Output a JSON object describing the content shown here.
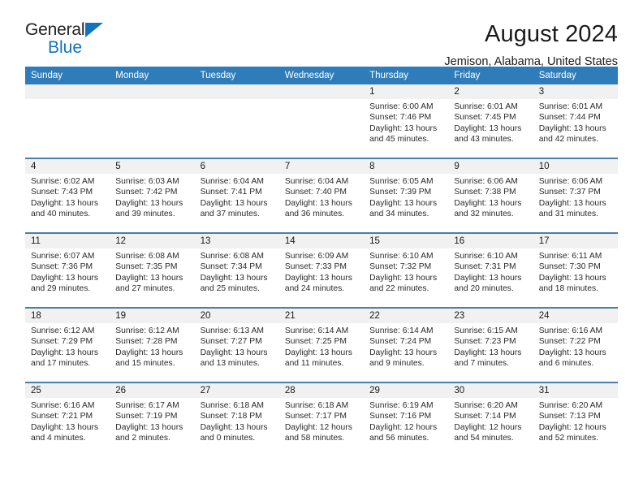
{
  "brand": {
    "name_part1": "General",
    "name_part2": "Blue",
    "accent_color": "#1275bc",
    "triangle_icon": "triangle-icon"
  },
  "header": {
    "title": "August 2024",
    "subtitle": "Jemison, Alabama, United States"
  },
  "calendar": {
    "header_bg": "#2e7cba",
    "row_divider_color": "#4a7fa8",
    "daynum_band_bg": "#f1f1f1",
    "weekdays": [
      "Sunday",
      "Monday",
      "Tuesday",
      "Wednesday",
      "Thursday",
      "Friday",
      "Saturday"
    ],
    "weeks": [
      [
        {
          "day": "",
          "sunrise": "",
          "sunset": "",
          "daylight1": "",
          "daylight2": "",
          "empty": true
        },
        {
          "day": "",
          "sunrise": "",
          "sunset": "",
          "daylight1": "",
          "daylight2": "",
          "empty": true
        },
        {
          "day": "",
          "sunrise": "",
          "sunset": "",
          "daylight1": "",
          "daylight2": "",
          "empty": true
        },
        {
          "day": "",
          "sunrise": "",
          "sunset": "",
          "daylight1": "",
          "daylight2": "",
          "empty": true
        },
        {
          "day": "1",
          "sunrise": "Sunrise: 6:00 AM",
          "sunset": "Sunset: 7:46 PM",
          "daylight1": "Daylight: 13 hours",
          "daylight2": "and 45 minutes."
        },
        {
          "day": "2",
          "sunrise": "Sunrise: 6:01 AM",
          "sunset": "Sunset: 7:45 PM",
          "daylight1": "Daylight: 13 hours",
          "daylight2": "and 43 minutes."
        },
        {
          "day": "3",
          "sunrise": "Sunrise: 6:01 AM",
          "sunset": "Sunset: 7:44 PM",
          "daylight1": "Daylight: 13 hours",
          "daylight2": "and 42 minutes."
        }
      ],
      [
        {
          "day": "4",
          "sunrise": "Sunrise: 6:02 AM",
          "sunset": "Sunset: 7:43 PM",
          "daylight1": "Daylight: 13 hours",
          "daylight2": "and 40 minutes."
        },
        {
          "day": "5",
          "sunrise": "Sunrise: 6:03 AM",
          "sunset": "Sunset: 7:42 PM",
          "daylight1": "Daylight: 13 hours",
          "daylight2": "and 39 minutes."
        },
        {
          "day": "6",
          "sunrise": "Sunrise: 6:04 AM",
          "sunset": "Sunset: 7:41 PM",
          "daylight1": "Daylight: 13 hours",
          "daylight2": "and 37 minutes."
        },
        {
          "day": "7",
          "sunrise": "Sunrise: 6:04 AM",
          "sunset": "Sunset: 7:40 PM",
          "daylight1": "Daylight: 13 hours",
          "daylight2": "and 36 minutes."
        },
        {
          "day": "8",
          "sunrise": "Sunrise: 6:05 AM",
          "sunset": "Sunset: 7:39 PM",
          "daylight1": "Daylight: 13 hours",
          "daylight2": "and 34 minutes."
        },
        {
          "day": "9",
          "sunrise": "Sunrise: 6:06 AM",
          "sunset": "Sunset: 7:38 PM",
          "daylight1": "Daylight: 13 hours",
          "daylight2": "and 32 minutes."
        },
        {
          "day": "10",
          "sunrise": "Sunrise: 6:06 AM",
          "sunset": "Sunset: 7:37 PM",
          "daylight1": "Daylight: 13 hours",
          "daylight2": "and 31 minutes."
        }
      ],
      [
        {
          "day": "11",
          "sunrise": "Sunrise: 6:07 AM",
          "sunset": "Sunset: 7:36 PM",
          "daylight1": "Daylight: 13 hours",
          "daylight2": "and 29 minutes."
        },
        {
          "day": "12",
          "sunrise": "Sunrise: 6:08 AM",
          "sunset": "Sunset: 7:35 PM",
          "daylight1": "Daylight: 13 hours",
          "daylight2": "and 27 minutes."
        },
        {
          "day": "13",
          "sunrise": "Sunrise: 6:08 AM",
          "sunset": "Sunset: 7:34 PM",
          "daylight1": "Daylight: 13 hours",
          "daylight2": "and 25 minutes."
        },
        {
          "day": "14",
          "sunrise": "Sunrise: 6:09 AM",
          "sunset": "Sunset: 7:33 PM",
          "daylight1": "Daylight: 13 hours",
          "daylight2": "and 24 minutes."
        },
        {
          "day": "15",
          "sunrise": "Sunrise: 6:10 AM",
          "sunset": "Sunset: 7:32 PM",
          "daylight1": "Daylight: 13 hours",
          "daylight2": "and 22 minutes."
        },
        {
          "day": "16",
          "sunrise": "Sunrise: 6:10 AM",
          "sunset": "Sunset: 7:31 PM",
          "daylight1": "Daylight: 13 hours",
          "daylight2": "and 20 minutes."
        },
        {
          "day": "17",
          "sunrise": "Sunrise: 6:11 AM",
          "sunset": "Sunset: 7:30 PM",
          "daylight1": "Daylight: 13 hours",
          "daylight2": "and 18 minutes."
        }
      ],
      [
        {
          "day": "18",
          "sunrise": "Sunrise: 6:12 AM",
          "sunset": "Sunset: 7:29 PM",
          "daylight1": "Daylight: 13 hours",
          "daylight2": "and 17 minutes."
        },
        {
          "day": "19",
          "sunrise": "Sunrise: 6:12 AM",
          "sunset": "Sunset: 7:28 PM",
          "daylight1": "Daylight: 13 hours",
          "daylight2": "and 15 minutes."
        },
        {
          "day": "20",
          "sunrise": "Sunrise: 6:13 AM",
          "sunset": "Sunset: 7:27 PM",
          "daylight1": "Daylight: 13 hours",
          "daylight2": "and 13 minutes."
        },
        {
          "day": "21",
          "sunrise": "Sunrise: 6:14 AM",
          "sunset": "Sunset: 7:25 PM",
          "daylight1": "Daylight: 13 hours",
          "daylight2": "and 11 minutes."
        },
        {
          "day": "22",
          "sunrise": "Sunrise: 6:14 AM",
          "sunset": "Sunset: 7:24 PM",
          "daylight1": "Daylight: 13 hours",
          "daylight2": "and 9 minutes."
        },
        {
          "day": "23",
          "sunrise": "Sunrise: 6:15 AM",
          "sunset": "Sunset: 7:23 PM",
          "daylight1": "Daylight: 13 hours",
          "daylight2": "and 7 minutes."
        },
        {
          "day": "24",
          "sunrise": "Sunrise: 6:16 AM",
          "sunset": "Sunset: 7:22 PM",
          "daylight1": "Daylight: 13 hours",
          "daylight2": "and 6 minutes."
        }
      ],
      [
        {
          "day": "25",
          "sunrise": "Sunrise: 6:16 AM",
          "sunset": "Sunset: 7:21 PM",
          "daylight1": "Daylight: 13 hours",
          "daylight2": "and 4 minutes."
        },
        {
          "day": "26",
          "sunrise": "Sunrise: 6:17 AM",
          "sunset": "Sunset: 7:19 PM",
          "daylight1": "Daylight: 13 hours",
          "daylight2": "and 2 minutes."
        },
        {
          "day": "27",
          "sunrise": "Sunrise: 6:18 AM",
          "sunset": "Sunset: 7:18 PM",
          "daylight1": "Daylight: 13 hours",
          "daylight2": "and 0 minutes."
        },
        {
          "day": "28",
          "sunrise": "Sunrise: 6:18 AM",
          "sunset": "Sunset: 7:17 PM",
          "daylight1": "Daylight: 12 hours",
          "daylight2": "and 58 minutes."
        },
        {
          "day": "29",
          "sunrise": "Sunrise: 6:19 AM",
          "sunset": "Sunset: 7:16 PM",
          "daylight1": "Daylight: 12 hours",
          "daylight2": "and 56 minutes."
        },
        {
          "day": "30",
          "sunrise": "Sunrise: 6:20 AM",
          "sunset": "Sunset: 7:14 PM",
          "daylight1": "Daylight: 12 hours",
          "daylight2": "and 54 minutes."
        },
        {
          "day": "31",
          "sunrise": "Sunrise: 6:20 AM",
          "sunset": "Sunset: 7:13 PM",
          "daylight1": "Daylight: 12 hours",
          "daylight2": "and 52 minutes."
        }
      ]
    ]
  }
}
